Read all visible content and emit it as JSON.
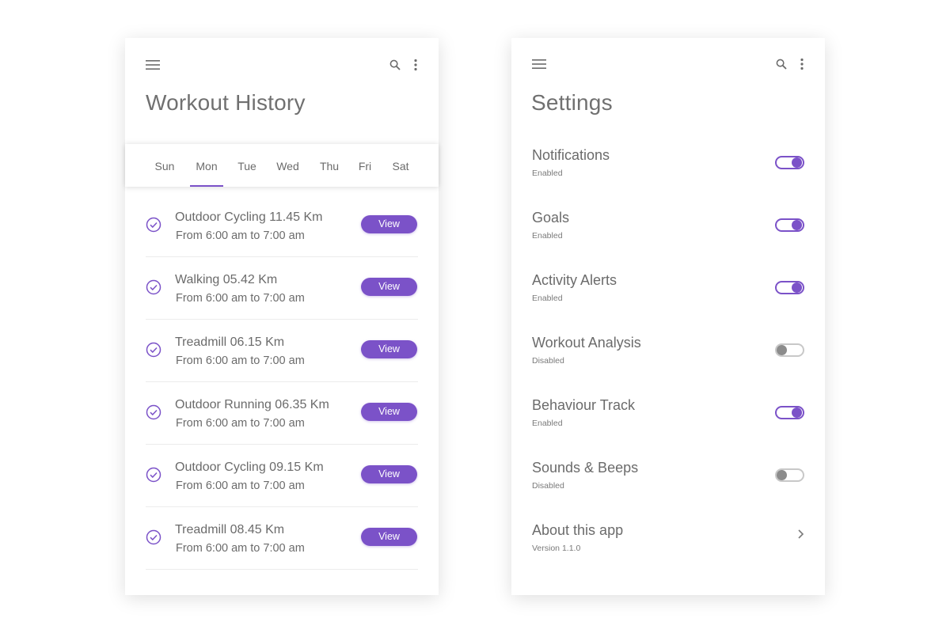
{
  "workout_history": {
    "title": "Workout History",
    "days": [
      {
        "label": "Sun",
        "selected": false
      },
      {
        "label": "Mon",
        "selected": true
      },
      {
        "label": "Tue",
        "selected": false
      },
      {
        "label": "Wed",
        "selected": false
      },
      {
        "label": "Thu",
        "selected": false
      },
      {
        "label": "Fri",
        "selected": false
      },
      {
        "label": "Sat",
        "selected": false
      }
    ],
    "items": [
      {
        "title": "Outdoor Cycling 11.45 Km",
        "time": "From 6:00 am to 7:00 am",
        "button": "View"
      },
      {
        "title": "Walking 05.42 Km",
        "time": "From 6:00 am to 7:00 am",
        "button": "View"
      },
      {
        "title": "Treadmill 06.15 Km",
        "time": "From 6:00 am to 7:00 am",
        "button": "View"
      },
      {
        "title": "Outdoor Running 06.35 Km",
        "time": "From 6:00 am to 7:00 am",
        "button": "View"
      },
      {
        "title": "Outdoor Cycling 09.15 Km",
        "time": "From 6:00 am to 7:00 am",
        "button": "View"
      },
      {
        "title": "Treadmill 08.45 Km",
        "time": "From 6:00 am to 7:00 am",
        "button": "View"
      }
    ]
  },
  "settings": {
    "title": "Settings",
    "items": [
      {
        "title": "Notifications",
        "status": "Enabled",
        "on": true
      },
      {
        "title": "Goals",
        "status": "Enabled",
        "on": true
      },
      {
        "title": "Activity Alerts",
        "status": "Enabled",
        "on": true
      },
      {
        "title": "Workout Analysis",
        "status": "Disabled",
        "on": false
      },
      {
        "title": "Behaviour Track",
        "status": "Enabled",
        "on": true
      },
      {
        "title": "Sounds & Beeps",
        "status": "Disabled",
        "on": false
      }
    ],
    "about": {
      "title": "About this app",
      "version": "Version 1.1.0"
    }
  },
  "icons": {
    "menu": "hamburger-menu-icon",
    "search": "search-icon",
    "more": "more-vertical-icon",
    "check": "check-circle-icon",
    "chevron": "chevron-right-icon"
  },
  "colors": {
    "accent": "#7b52c8",
    "text": "#6b6b6b",
    "toggle_off": "#c8c8c8"
  }
}
